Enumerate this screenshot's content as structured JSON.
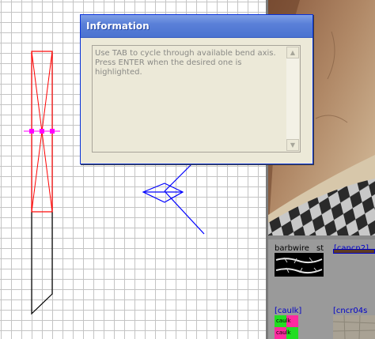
{
  "dialog": {
    "title": "Information",
    "message_lines": [
      "Use TAB to cycle through available bend axis.",
      "Press ENTER when the desired one is",
      "highlighted."
    ]
  },
  "texture_browser": {
    "items": [
      {
        "label": "barbwire",
        "selected": false
      },
      {
        "label": "st",
        "selected": false
      },
      {
        "label": "[cancn2]",
        "selected": true
      },
      {
        "label": "[caulk]",
        "selected": true
      },
      {
        "label": "[cncr04s",
        "selected": true
      }
    ],
    "thumb_caption": "caulk"
  },
  "icons": {
    "scroll_up": "scroll-up-arrow-icon",
    "scroll_down": "scroll-down-arrow-icon"
  },
  "colors": {
    "titlebar": "#5a80d8",
    "brush_selected": "#ff0000",
    "control_handles": "#ff00ff",
    "patch_tool": "#0000ff",
    "brush_unselected": "#000000",
    "grid": "#c4c4c4"
  }
}
